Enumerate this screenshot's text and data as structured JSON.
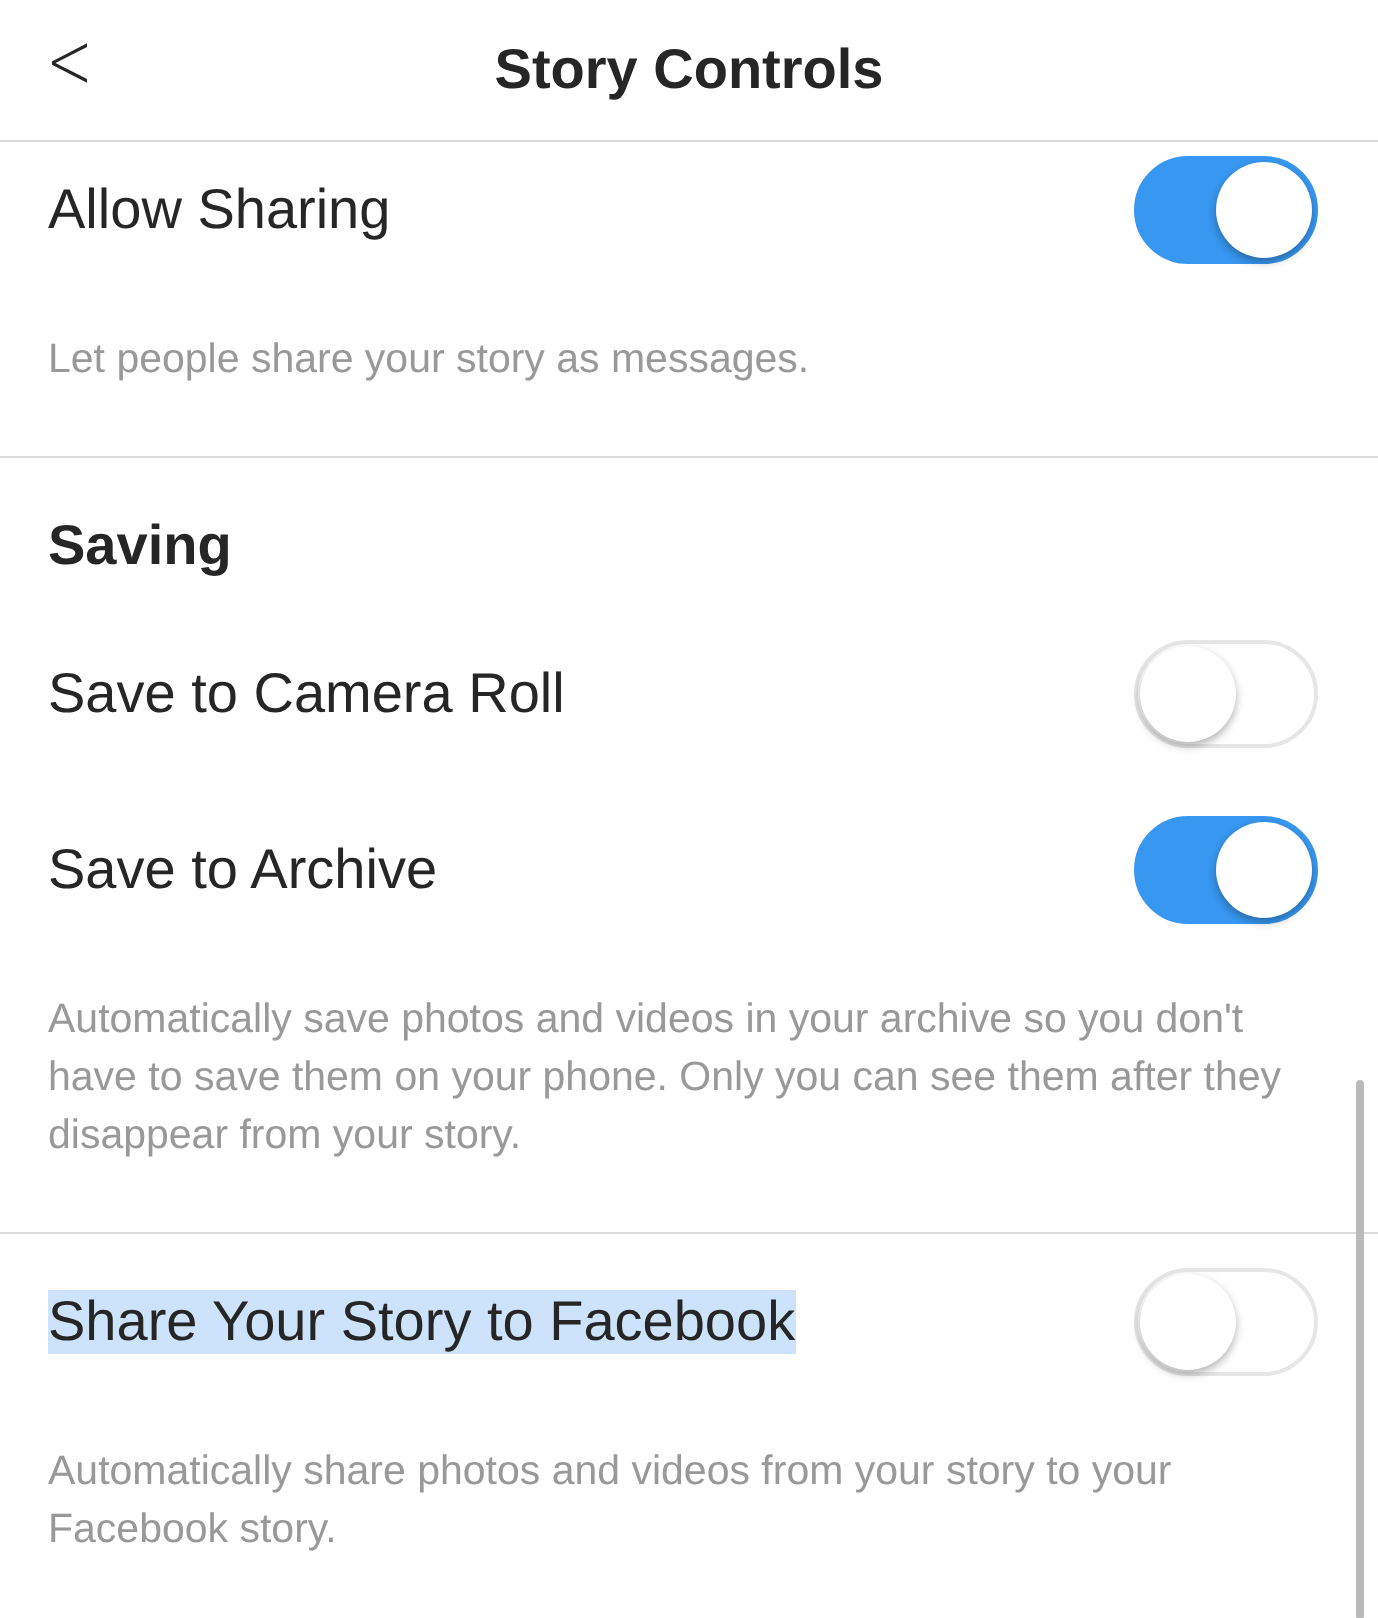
{
  "header": {
    "back": "<",
    "title": "Story Controls"
  },
  "sections": [
    {
      "items": [
        {
          "kind": "toggle",
          "label": "Allow Sharing",
          "on": true,
          "highlighted": false
        },
        {
          "kind": "note",
          "text": "Let people share your story as messages."
        }
      ]
    },
    {
      "items": [
        {
          "kind": "heading",
          "text": "Saving"
        },
        {
          "kind": "toggle",
          "label": "Save to Camera Roll",
          "on": false,
          "highlighted": false
        },
        {
          "kind": "toggle",
          "label": "Save to Archive",
          "on": true,
          "highlighted": false
        },
        {
          "kind": "note",
          "text": "Automatically save photos and videos in your archive so you don't have to save them on your phone. Only you can see them after they disappear from your story."
        }
      ]
    },
    {
      "items": [
        {
          "kind": "toggle",
          "label": "Share Your Story to Facebook",
          "on": false,
          "highlighted": true
        },
        {
          "kind": "note",
          "text": "Automatically share photos and videos from your story to your Facebook story."
        }
      ]
    }
  ]
}
